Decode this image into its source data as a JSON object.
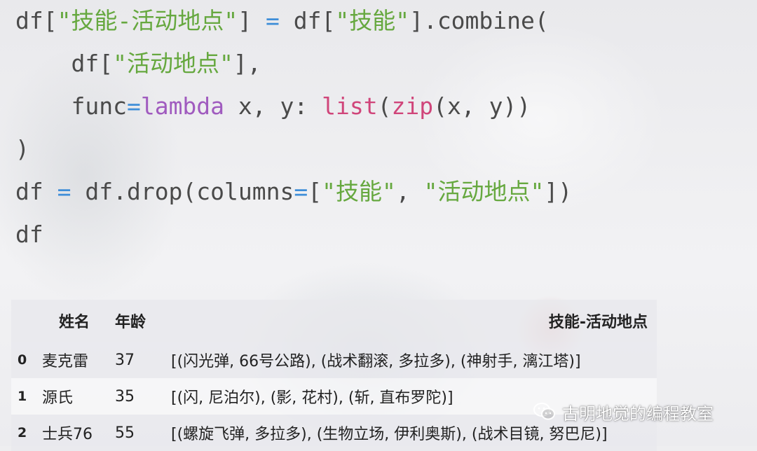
{
  "code": {
    "lines": [
      [
        {
          "t": "df[",
          "c": "plain"
        },
        {
          "t": "\"技能-活动地点\"",
          "c": "str"
        },
        {
          "t": "] ",
          "c": "plain"
        },
        {
          "t": "=",
          "c": "op"
        },
        {
          "t": " df[",
          "c": "plain"
        },
        {
          "t": "\"技能\"",
          "c": "str"
        },
        {
          "t": "].combine(",
          "c": "plain"
        }
      ],
      [
        {
          "t": "    df[",
          "c": "plain"
        },
        {
          "t": "\"活动地点\"",
          "c": "str"
        },
        {
          "t": "],",
          "c": "plain"
        }
      ],
      [
        {
          "t": "    func",
          "c": "plain"
        },
        {
          "t": "=",
          "c": "op"
        },
        {
          "t": "lambda",
          "c": "kw"
        },
        {
          "t": " x, y: ",
          "c": "plain"
        },
        {
          "t": "list",
          "c": "fn"
        },
        {
          "t": "(",
          "c": "plain"
        },
        {
          "t": "zip",
          "c": "fn"
        },
        {
          "t": "(x, y))",
          "c": "plain"
        }
      ],
      [
        {
          "t": ")",
          "c": "plain"
        }
      ],
      [
        {
          "t": "df ",
          "c": "plain"
        },
        {
          "t": "=",
          "c": "op"
        },
        {
          "t": " df.drop(columns",
          "c": "plain"
        },
        {
          "t": "=",
          "c": "op"
        },
        {
          "t": "[",
          "c": "plain"
        },
        {
          "t": "\"技能\"",
          "c": "str"
        },
        {
          "t": ", ",
          "c": "plain"
        },
        {
          "t": "\"活动地点\"",
          "c": "str"
        },
        {
          "t": "])",
          "c": "plain"
        }
      ],
      [
        {
          "t": "df",
          "c": "plain"
        }
      ]
    ]
  },
  "table": {
    "columns": {
      "name": "姓名",
      "age": "年龄",
      "skill": "技能-活动地点"
    },
    "rows": [
      {
        "index": "0",
        "name": "麦克雷",
        "age": "37",
        "skill": "[(闪光弹, 66号公路), (战术翻滚, 多拉多), (神射手, 漓江塔)]"
      },
      {
        "index": "1",
        "name": "源氏",
        "age": "35",
        "skill": "[(闪, 尼泊尔), (影, 花村), (斩, 直布罗陀)]"
      },
      {
        "index": "2",
        "name": "士兵76",
        "age": "55",
        "skill": "[(螺旋飞弹, 多拉多), (生物立场, 伊利奥斯), (战术目镜, 努巴尼)]"
      }
    ]
  },
  "watermark": {
    "text": "古明地觉的编程教室",
    "icon": "wechat-icon"
  }
}
